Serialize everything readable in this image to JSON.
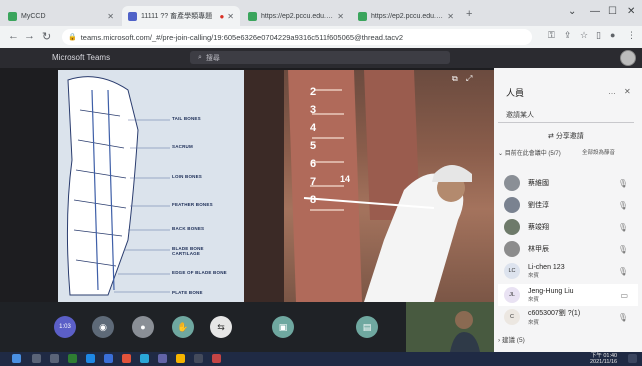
{
  "browser": {
    "tabs": [
      {
        "label": "MyCCD",
        "color": "#3ba55d"
      },
      {
        "label": "11111 ?? 畜產學類專題",
        "color": "#4f62c8"
      },
      {
        "label": "https://ep2.pccu.edu.tw/eve",
        "color": "#3ba55d"
      },
      {
        "label": "https://ep2.pccu.edu.tw/eve",
        "color": "#3ba55d"
      }
    ],
    "url": "teams.microsoft.com/_#/pre-join-calling/19:605e6326e0704229a9316c511f605065@thread.tacv2"
  },
  "teams": {
    "app_title": "Microsoft Teams",
    "search_placeholder": "搜尋"
  },
  "slide": {
    "labels": [
      "TAIL BONES",
      "SACRUM",
      "LOIN BONES",
      "FEATHER BONES",
      "BACK BONES",
      "BLADE BONE CARTILAGE",
      "EDGE OF BLADE BONE",
      "PLATE BONE"
    ]
  },
  "camera": {
    "rib_numbers": [
      "2",
      "3",
      "4",
      "5",
      "6",
      "7",
      "8"
    ],
    "marker": "14"
  },
  "controls": {
    "timer": "1:03"
  },
  "panel": {
    "title": "人員",
    "invite_label": "邀請某人",
    "share_label": "分享邀請",
    "section_header": "目前在此會議中 (5/7)",
    "section_action": "全部設為靜音",
    "participants": [
      {
        "name": "蔡維國",
        "role": "",
        "avatar_color": "#8a8f96",
        "initials": ""
      },
      {
        "name": "劉佳淳",
        "role": "",
        "avatar_color": "#7a8290",
        "initials": ""
      },
      {
        "name": "蔡竣翔",
        "role": "",
        "avatar_color": "#6e7a6a",
        "initials": ""
      },
      {
        "name": "林甲辰",
        "role": "",
        "avatar_color": "#8c8c8c",
        "initials": ""
      },
      {
        "name": "Li-chen 123",
        "role": "來賓",
        "avatar_color": "#dde3ee",
        "initials": "LC"
      },
      {
        "name": "Jeng-Hung Liu",
        "role": "來賓",
        "avatar_color": "#e9e2f3",
        "initials": "JL"
      },
      {
        "name": "c6053007劉 ?(1)",
        "role": "來賓",
        "avatar_color": "#ece7e1",
        "initials": "C"
      }
    ],
    "guests_label": "建議 (5)"
  },
  "taskbar": {
    "time": "下午 01:40",
    "date": "2021/11/16"
  }
}
